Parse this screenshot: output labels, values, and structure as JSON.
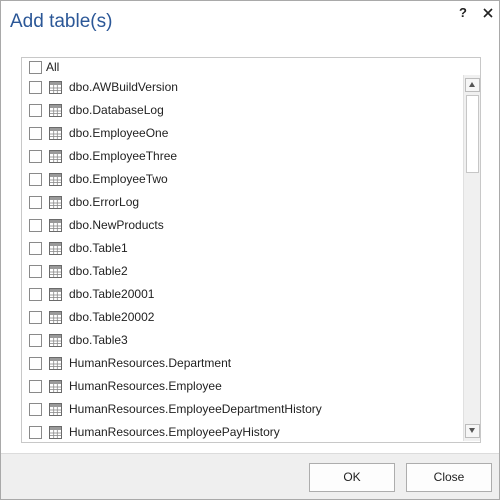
{
  "dialog": {
    "title": "Add table(s)",
    "help_icon": "?",
    "close_icon": "x"
  },
  "list": {
    "all_label": "All",
    "items": [
      "dbo.AWBuildVersion",
      "dbo.DatabaseLog",
      "dbo.EmployeeOne",
      "dbo.EmployeeThree",
      "dbo.EmployeeTwo",
      "dbo.ErrorLog",
      "dbo.NewProducts",
      "dbo.Table1",
      "dbo.Table2",
      "dbo.Table20001",
      "dbo.Table20002",
      "dbo.Table3",
      "HumanResources.Department",
      "HumanResources.Employee",
      "HumanResources.EmployeeDepartmentHistory",
      "HumanResources.EmployeePayHistory"
    ]
  },
  "buttons": {
    "ok": "OK",
    "close": "Close"
  },
  "colors": {
    "title": "#2b5797",
    "footer": "#efefef"
  }
}
